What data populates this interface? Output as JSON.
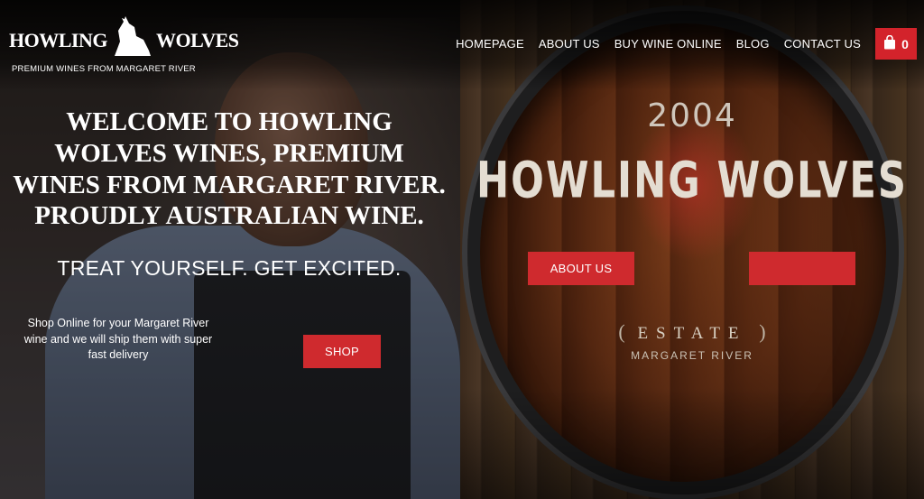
{
  "header": {
    "logo_left": "HOWLING",
    "logo_right": "WOLVES",
    "tagline": "PREMIUM WINES FROM MARGARET RIVER",
    "cart_count": "0"
  },
  "nav": {
    "items": [
      "HOMEPAGE",
      "ABOUT US",
      "BUY WINE ONLINE",
      "BLOG",
      "CONTACT US"
    ]
  },
  "hero_left": {
    "welcome": "WELCOME TO HOWLING WOLVES WINES, PREMIUM WINES FROM MARGARET RIVER. PROUDLY AUSTRALIAN WINE.",
    "treat": "TREAT YOURSELF. GET EXCITED.",
    "shop_text": "Shop Online for your Margaret River wine and we will ship them with super fast delivery",
    "shop_button": "SHOP"
  },
  "hero_right": {
    "year": "2004",
    "brand": "HOWLING WOLVES",
    "estate": "ESTATE",
    "region": "MARGARET RIVER",
    "about_button": "ABOUT US",
    "second_button": ""
  },
  "colors": {
    "accent": "#d3232b",
    "text": "#ffffff"
  },
  "icons": {
    "cart": "shopping-bag-icon",
    "logo": "wolf-logo-icon"
  }
}
